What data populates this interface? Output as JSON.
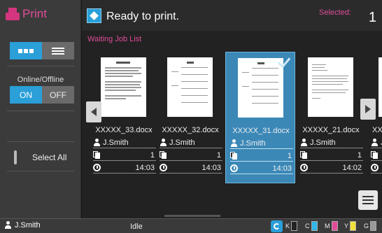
{
  "app": {
    "title": "Print"
  },
  "header": {
    "status": "Ready to print.",
    "selected_label": "Selected:",
    "selected_count": "1"
  },
  "sidebar": {
    "view_modes": [
      "grid",
      "list"
    ],
    "online_label": "Online/Offline",
    "on_label": "ON",
    "off_label": "OFF",
    "select_all": "Select All"
  },
  "main": {
    "section_title": "Waiting Job List",
    "jobs": [
      {
        "name": "XXXXX_33.docx",
        "owner": "J.Smith",
        "copies": "1",
        "time": "14:03",
        "selected": false
      },
      {
        "name": "XXXXX_32.docx",
        "owner": "J.Smith",
        "copies": "1",
        "time": "14:03",
        "selected": false
      },
      {
        "name": "XXXXX_31.docx",
        "owner": "J.Smith",
        "copies": "1",
        "time": "14:03",
        "selected": true
      },
      {
        "name": "XXXXX_21.docx",
        "owner": "J.Smith",
        "copies": "1",
        "time": "14:02",
        "selected": false
      },
      {
        "name": "XX",
        "owner": "J.",
        "copies": "",
        "time": "",
        "selected": false
      }
    ]
  },
  "statusbar": {
    "user": "J.Smith",
    "state": "Idle",
    "toner": [
      {
        "label": "K",
        "color": "#222222",
        "level": 0.0
      },
      {
        "label": "C",
        "color": "#2fb5e8",
        "level": 1.0
      },
      {
        "label": "M",
        "color": "#e04c98",
        "level": 1.0
      },
      {
        "label": "Y",
        "color": "#f2e03a",
        "level": 1.0
      },
      {
        "label": "G",
        "color": "#9a9a9a",
        "level": 1.0
      }
    ]
  },
  "colors": {
    "accent": "#2a9fd8",
    "brand": "#e04c98"
  }
}
